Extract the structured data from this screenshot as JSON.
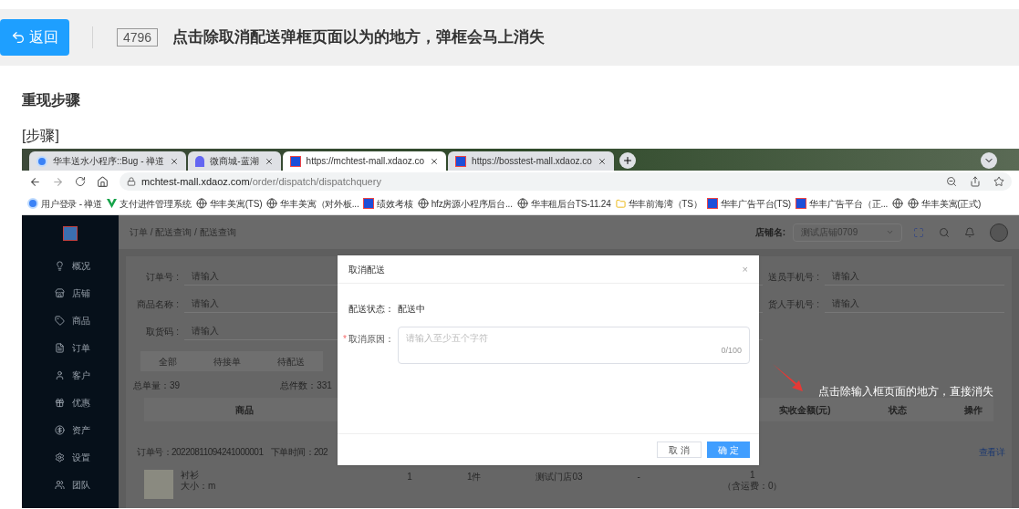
{
  "header": {
    "back_button": "返回",
    "issue_id": "4796",
    "title": "点击除取消配送弹框页面以为的地方，弹框会马上消失"
  },
  "section_heading": "重现步骤",
  "steps_label": "[步骤]",
  "screenshot": {
    "browser": {
      "tabs": [
        {
          "title": "华丰送水小程序::Bug - 禅道",
          "selected": false
        },
        {
          "title": "微商城-蓝湖",
          "selected": false
        },
        {
          "title": "https://mchtest-mall.xdaoz.co",
          "selected": true
        },
        {
          "title": "https://bosstest-mall.xdaoz.co",
          "selected": false
        }
      ],
      "address": {
        "host": "mchtest-mall.xdaoz.com",
        "path": "/order/dispatch/dispatchquery"
      },
      "bookmarks": [
        {
          "kind": "labeled",
          "label": "用户登录 - 禅道"
        },
        {
          "kind": "labeled",
          "label": "支付进件管理系统"
        },
        {
          "kind": "labeled",
          "label": "华丰美寓(TS)"
        },
        {
          "kind": "labeled",
          "label": "华丰美寓（对外板..."
        },
        {
          "kind": "labeled",
          "label": "绩效考核"
        },
        {
          "kind": "labeled",
          "label": "hfz房源小程序后台..."
        },
        {
          "kind": "labeled",
          "label": "华丰租后台TS-11.24"
        },
        {
          "kind": "labeled",
          "label": "华丰前海湾（TS）"
        },
        {
          "kind": "labeled",
          "label": "华丰广告平台(TS)"
        },
        {
          "kind": "labeled",
          "label": "华丰广告平台（正..."
        },
        {
          "kind": "icon_only"
        },
        {
          "kind": "labeled",
          "label": "华丰美寓(正式)"
        }
      ]
    },
    "app": {
      "sidebar": [
        "概况",
        "店铺",
        "商品",
        "订单",
        "客户",
        "优惠",
        "资产",
        "设置",
        "团队"
      ],
      "breadcrumb": "订单 / 配送查询 / 配送查询",
      "store_label": "店铺名:",
      "store_value": "测试店铺0709",
      "filters_left": [
        {
          "label": "订单号 :",
          "placeholder": "请输入"
        },
        {
          "label": "商品名称 :",
          "placeholder": "请输入"
        },
        {
          "label": "取货码 :",
          "placeholder": "请输入"
        }
      ],
      "filters_right": [
        {
          "label": "送员手机号 :",
          "placeholder": "请输入"
        },
        {
          "label": "货人手机号 :",
          "placeholder": "请输入"
        }
      ],
      "tabs": [
        "全部",
        "待接单",
        "待配送"
      ],
      "stats": [
        "总单量：39",
        "总件数：331"
      ],
      "columns_left": [
        "商品"
      ],
      "columns_right": [
        "实收金额(元)",
        "状态",
        "操作"
      ],
      "order": {
        "number": "订单号：20220811094241000001",
        "time": "下单时间：202",
        "link": "查看详"
      },
      "product": {
        "name": "衬衫",
        "size": "大小：m"
      },
      "cells": [
        "1",
        "1件",
        "测试门店03",
        "-"
      ],
      "amount": {
        "value": "1",
        "note": "（含运费：0）"
      }
    },
    "dialog": {
      "title": "取消配送",
      "close": "×",
      "status_label": "配送状态：",
      "status_value": "配送中",
      "required_mark": "*",
      "reason_label": "取消原因：",
      "reason_placeholder": "请输入至少五个字符",
      "counter": "0/100",
      "cancel_button": "取 消",
      "confirm_button": "确 定"
    },
    "annotation": "点击除输入框页面的地方，直接消失"
  }
}
